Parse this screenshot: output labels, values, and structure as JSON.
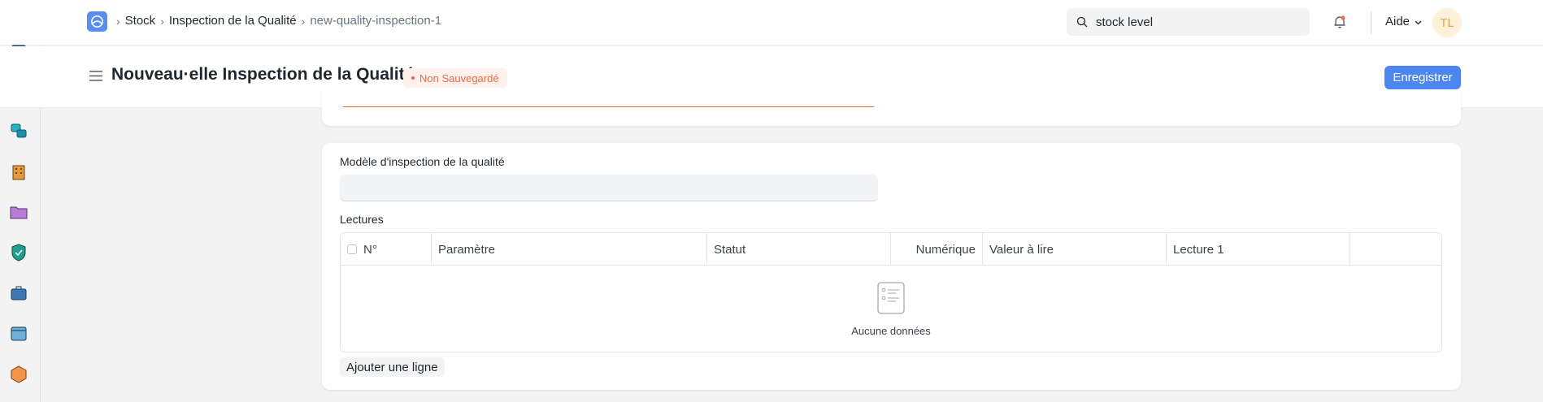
{
  "breadcrumb": {
    "items": [
      "Stock",
      "Inspection de la Qualité"
    ],
    "current": "new-quality-inspection-1"
  },
  "search": {
    "value": "stock level"
  },
  "navbar": {
    "help_label": "Aide",
    "avatar_initials": "TL"
  },
  "page": {
    "title": "Nouveau·elle Inspection de la Qualité",
    "status": "Non Sauvegardé",
    "save_label": "Enregistrer"
  },
  "form": {
    "template_label": "Modèle d'inspection de la qualité",
    "template_value": "",
    "readings_label": "Lectures",
    "columns": [
      "N°",
      "Paramètre",
      "Statut",
      "Numérique",
      "Valeur à lire",
      "Lecture 1"
    ],
    "empty_text": "Aucune données",
    "add_row_label": "Ajouter une ligne"
  },
  "colors": {
    "accent": "#4d86f0",
    "unsaved": "#e86c4b"
  },
  "sidebar_icons": [
    "monitor-icon",
    "bug-icon",
    "shapes-icon",
    "building-icon",
    "folder-icon",
    "shield-icon",
    "briefcase-icon",
    "window-icon",
    "hexagon-icon"
  ]
}
